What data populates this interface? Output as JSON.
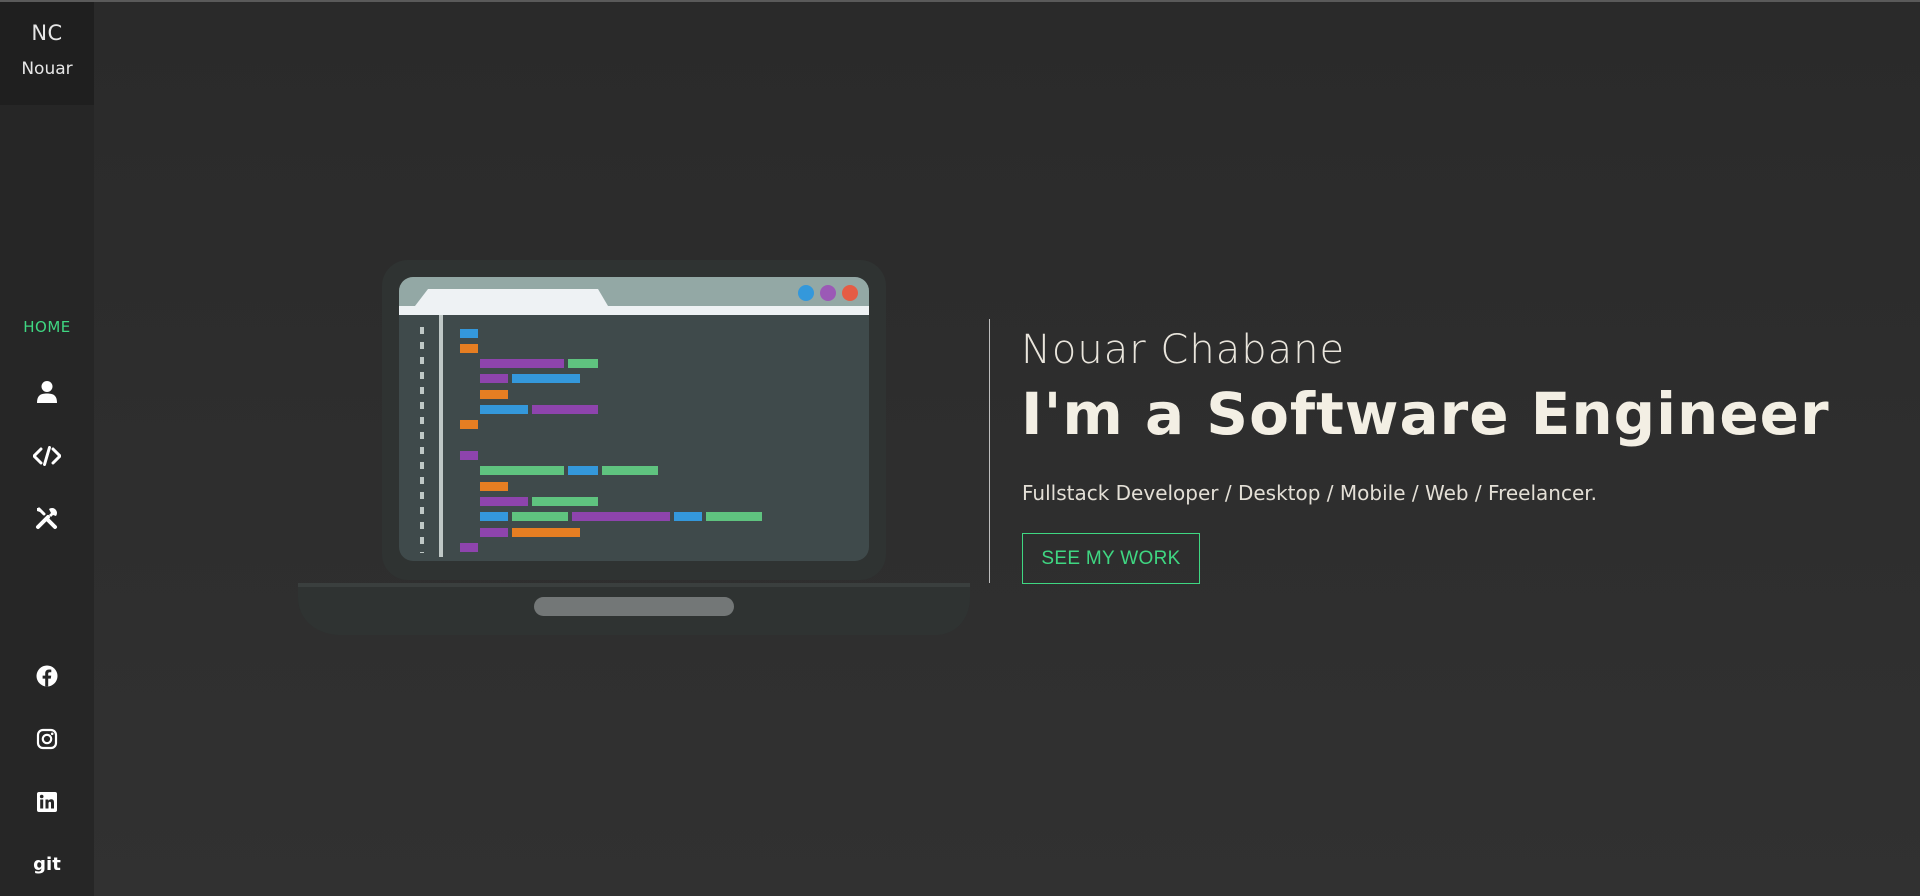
{
  "sidebar": {
    "logo_initials": "NC",
    "logo_name": "Nouar",
    "nav": {
      "home_label": "HOME",
      "items": [
        {
          "icon": "user-icon"
        },
        {
          "icon": "code-icon"
        },
        {
          "icon": "tools-icon"
        }
      ]
    },
    "social": [
      {
        "icon": "facebook-icon"
      },
      {
        "icon": "instagram-icon"
      },
      {
        "icon": "linkedin-icon"
      },
      {
        "icon": "git-icon",
        "label": "git"
      }
    ]
  },
  "hero": {
    "name": "Nouar Chabane",
    "title": "I'm a Software Engineer",
    "subtitle": "Fullstack Developer / Desktop / Mobile / Web / Freelancer.",
    "cta_label": "SEE MY WORK"
  },
  "colors": {
    "accent": "#3fd782",
    "background": "#2c2c2c",
    "sidebar": "#262626",
    "text": "#f3efe4"
  },
  "illustration": {
    "icon": "laptop-code-illustration"
  }
}
